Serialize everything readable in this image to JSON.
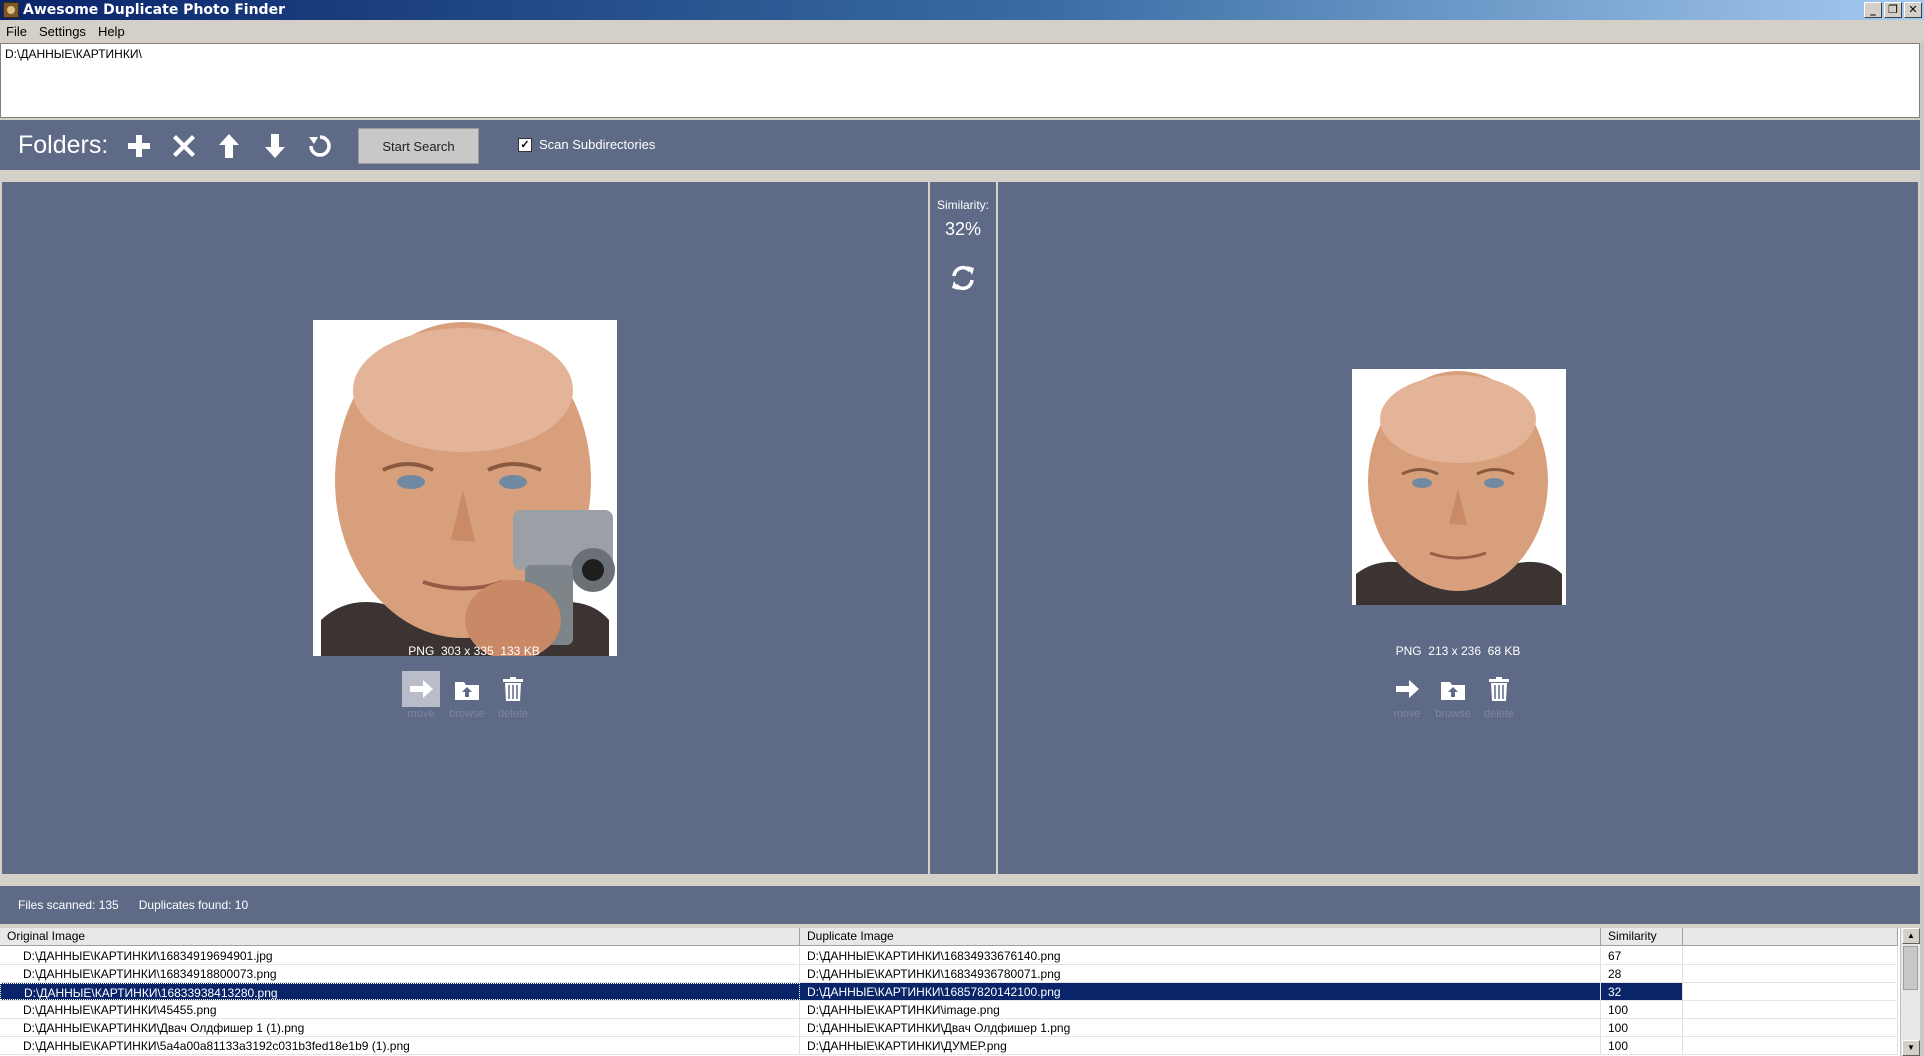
{
  "window": {
    "title": "Awesome Duplicate Photo Finder"
  },
  "menu": [
    "File",
    "Settings",
    "Help"
  ],
  "folders": {
    "paths": [
      "D:\\ДАННЫЕ\\КАРТИНКИ\\"
    ]
  },
  "toolbar": {
    "label": "Folders:",
    "icons": [
      "plus-icon",
      "close-icon",
      "arrow-up-icon",
      "arrow-down-icon",
      "refresh-icon"
    ],
    "start_search": "Start Search",
    "scan_subdirectories": {
      "label": "Scan Subdirectories",
      "checked": true
    }
  },
  "comparison": {
    "similarity_label": "Similarity:",
    "similarity_value": "32%",
    "left": {
      "info": "PNG  303 x 335  133 KB",
      "actions": {
        "move": "move",
        "browse": "browse",
        "delete": "delete"
      }
    },
    "right": {
      "info": "PNG  213 x 236  68 KB",
      "actions": {
        "move": "move",
        "browse": "browse",
        "delete": "delete"
      }
    }
  },
  "status": {
    "files_scanned": "Files scanned: 135",
    "duplicates_found": "Duplicates found: 10"
  },
  "table": {
    "columns": [
      "Original Image",
      "Duplicate Image",
      "Similarity",
      ""
    ],
    "rows": [
      {
        "original": "D:\\ДАННЫЕ\\КАРТИНКИ\\16834919694901.jpg",
        "duplicate": "D:\\ДАННЫЕ\\КАРТИНКИ\\16834933676140.png",
        "similarity": "67"
      },
      {
        "original": "D:\\ДАННЫЕ\\КАРТИНКИ\\16834918800073.png",
        "duplicate": "D:\\ДАННЫЕ\\КАРТИНКИ\\16834936780071.png",
        "similarity": "28"
      },
      {
        "original": "D:\\ДАННЫЕ\\КАРТИНКИ\\16833938413280.png",
        "duplicate": "D:\\ДАННЫЕ\\КАРТИНКИ\\16857820142100.png",
        "similarity": "32"
      },
      {
        "original": "D:\\ДАННЫЕ\\КАРТИНКИ\\45455.png",
        "duplicate": "D:\\ДАННЫЕ\\КАРТИНКИ\\image.png",
        "similarity": "100"
      },
      {
        "original": "D:\\ДАННЫЕ\\КАРТИНКИ\\Двач Олдфишер 1 (1).png",
        "duplicate": "D:\\ДАННЫЕ\\КАРТИНКИ\\Двач Олдфишер 1.png",
        "similarity": "100"
      },
      {
        "original": "D:\\ДАННЫЕ\\КАРТИНКИ\\5a4a00a81133a3192c031b3fed18e1b9 (1).png",
        "duplicate": "D:\\ДАННЫЕ\\КАРТИНКИ\\ДУМЕР.png",
        "similarity": "100"
      }
    ],
    "selected_row": 2
  },
  "colors": {
    "panel": "#5f6a87",
    "selection": "#0a246a",
    "titlebar": "#0a246a"
  }
}
